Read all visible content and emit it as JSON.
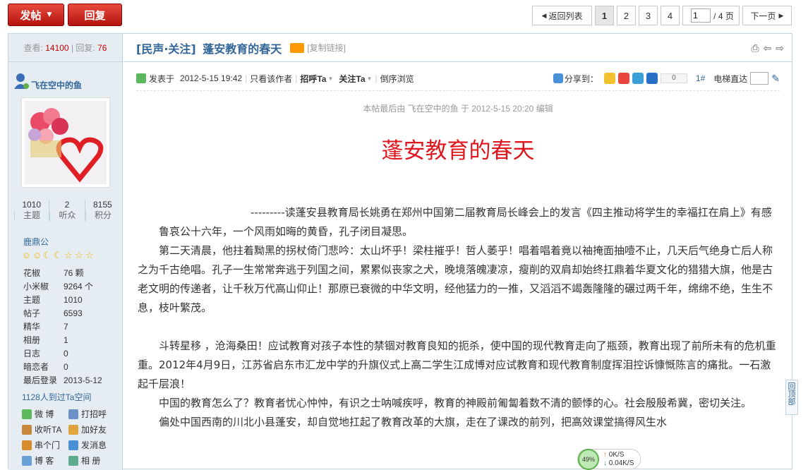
{
  "toolbar": {
    "post_label": "发帖",
    "reply_label": "回复",
    "back_label": "返回列表",
    "pages": [
      "1",
      "2",
      "3",
      "4"
    ],
    "current_page": "1",
    "page_input_value": "1",
    "page_total": "/ 4 页",
    "next_label": "下一页"
  },
  "sidebar": {
    "views_label": "查看:",
    "views": "14100",
    "sep": "|",
    "replies_label": "回复:",
    "replies": "76",
    "author": "飞在空中的鱼",
    "counts": [
      {
        "value": "1010",
        "label": "主题"
      },
      {
        "value": "2",
        "label": "听众"
      },
      {
        "value": "8155",
        "label": "积分"
      }
    ],
    "rank": "鹿鼎公",
    "info": [
      {
        "k": "花椒",
        "v": "76 颗"
      },
      {
        "k": "小米椒",
        "v": "9264 个"
      },
      {
        "k": "主题",
        "v": "1010"
      },
      {
        "k": "帖子",
        "v": "6593"
      },
      {
        "k": "精华",
        "v": "7"
      },
      {
        "k": "相册",
        "v": "1"
      },
      {
        "k": "日志",
        "v": "0"
      },
      {
        "k": "暗恋者",
        "v": "0"
      },
      {
        "k": "最后登录",
        "v": "2013-5-12"
      }
    ],
    "visitors": "1128人到过Ta空间",
    "actions": [
      "微 博",
      "打招呼",
      "收听TA",
      "加好友",
      "串个门",
      "发消息",
      "博 客",
      "相 册"
    ]
  },
  "thread": {
    "tag": "[民声·关注]",
    "title": "蓬安教育的春天",
    "copy_link": "[复制链接]"
  },
  "postbar": {
    "posted": "发表于",
    "time": "2012-5-15 19:42",
    "only_author": "只看该作者",
    "greet": "招呼Ta",
    "follow": "关注Ta",
    "reverse": "倒序浏览",
    "share_label": "分享到：",
    "share_count": "0",
    "floor": "1#",
    "elevator": "电梯直达"
  },
  "post": {
    "edited": "本帖最后由 飞在空中的鱼 于 2012-5-15 20:20 编辑",
    "title": "蓬安教育的春天",
    "paragraphs": [
      "---------读蓬安县教育局长姚勇在郑州中国第二届教育局长峰会上的发言《四主推动将学生的幸福扛在肩上》有感",
      "鲁哀公十六年，一个风雨如晦的黄昏，孔子闭目凝思。",
      "第二天清晨，他拄着黝黑的拐杖倚门悲吟：太山坏乎！梁柱摧乎！哲人萎乎！唱着唱着竟以袖掩面抽噎不止，几天后气绝身亡后人称之为千古绝唱。孔子一生常常奔逃于列国之间，累累似丧家之犬，晚境落魄凄凉，瘦削的双肩却始终扛鼎着华夏文化的猎猎大旗，他是古老文明的传递者，让千秋万代高山仰止！那原已衰微的中华文明，经他猛力的一推，又滔滔不竭轰隆隆的碾过两千年，绵绵不绝，生生不息，枝叶繁茂。",
      "斗转星移 ，沧海桑田！应试教育对孩子本性的禁锢对教育良知的扼杀，使中国的现代教育走向了瓶颈，教育出现了前所未有的危机重重。2012年4月9日，江苏省启东市汇龙中学的升旗仪式上高二学生江成博对应试教育和现代教育制度挥泪控诉慷慨陈言的痛批。一石激起千层浪！",
      "中国的教育怎么了？教育者忧心忡忡，有识之士呐喊疾呼，教育的神殿前匍匐着数不清的颤悸的心。社会殷殷希冀，密切关注。",
      "偏处中国西南的川北小县蓬安，却自觉地扛起了教育改革的大旗，走在了课改的前列，把高效课堂搞得风生水"
    ]
  },
  "backtop": "回顶部",
  "network": {
    "percent": "49%",
    "up": "0K/S",
    "down": "0.04K/S"
  },
  "colors": {
    "accent_red": "#c00",
    "link_blue": "#369",
    "title_red": "#e0161e",
    "frame_border": "#c2d5e3"
  }
}
